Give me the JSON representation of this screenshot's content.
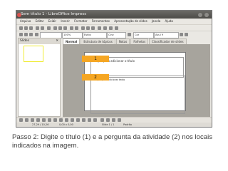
{
  "window": {
    "title": "Sem título 1 - LibreOffice Impress"
  },
  "menu": [
    "Arquivo",
    "Editar",
    "Exibir",
    "Inserir",
    "Formatar",
    "Ferramentas",
    "Apresentação de slides",
    "Janela",
    "Ajuda"
  ],
  "toolbar": {
    "zoom": "100%",
    "font_name": "Sans",
    "style": "Estilo",
    "color1": "Cinz",
    "color2": "Cor",
    "color3": "Azul 9"
  },
  "slides_panel": {
    "title": "Slides"
  },
  "tabs": [
    "Normal",
    "Estrutura de tópicos",
    "Notas",
    "Folhetos",
    "Classificador de slides"
  ],
  "slide": {
    "title_placeholder": "Clique para adicionar o título",
    "text_placeholder": "Clique para adicionar texto"
  },
  "markers": {
    "m1": "1",
    "m2": "2"
  },
  "status": {
    "position": "27,29 / 10,26",
    "size": "0,00 x 0,00",
    "slide_info": "Slide 1 / 1",
    "layout": "Padrão"
  },
  "caption": "Passo 2: Digite o título (1) e a pergunta da atividade (2) nos locais indicados na imagem.",
  "colors": {
    "titlebar": "#4c4b47",
    "window_bg": "#eae8e3",
    "workspace": "#a7a49d",
    "marker": "#f5a623",
    "thumb_border": "#f0ec34",
    "caption_text": "#404040"
  }
}
